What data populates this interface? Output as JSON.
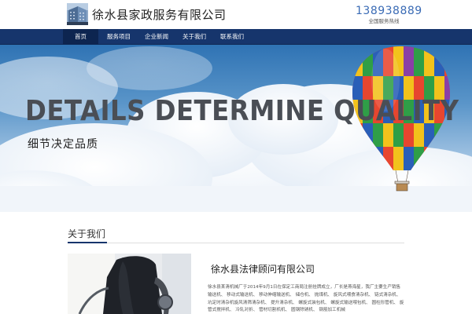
{
  "header": {
    "title": "徐水县家政服务有限公司",
    "hotline_number": "138938889",
    "hotline_label": "全国服务热线"
  },
  "nav": {
    "items": [
      {
        "label": "首页",
        "active": true
      },
      {
        "label": "服务项目",
        "active": false
      },
      {
        "label": "企业新闻",
        "active": false
      },
      {
        "label": "关于我们",
        "active": false
      },
      {
        "label": "联系我们",
        "active": false
      }
    ]
  },
  "banner": {
    "headline": "DETAILS DETERMINE QUALITY",
    "subheadline": "细节决定品质"
  },
  "about": {
    "section_title": "关于我们",
    "company_name": "徐水县法律顾问有限公司",
    "description": "徐水县某清机械厂于2014年9月1日在保定工商局注册挂牌成立，厂长是燕海星，我厂主要生产销售 输送机、 移动式输送机、 移动伸缩输送机、 储仓机、 抛煤机、 旋风式喂食清杂机、 链式清杂机、 坑定时清杂机旋风清筛清杂机、 提升清杂机、 螺旋式装包机、 螺旋式输送喂包机、 圆柱形管机、 旋管式搅拌机、 冷轧对折、 管材切割机机、 圆钢除锈机、 钢筋加工机械"
  },
  "colors": {
    "nav_bg": "#16356c",
    "accent_blue": "#3a6bb5"
  }
}
